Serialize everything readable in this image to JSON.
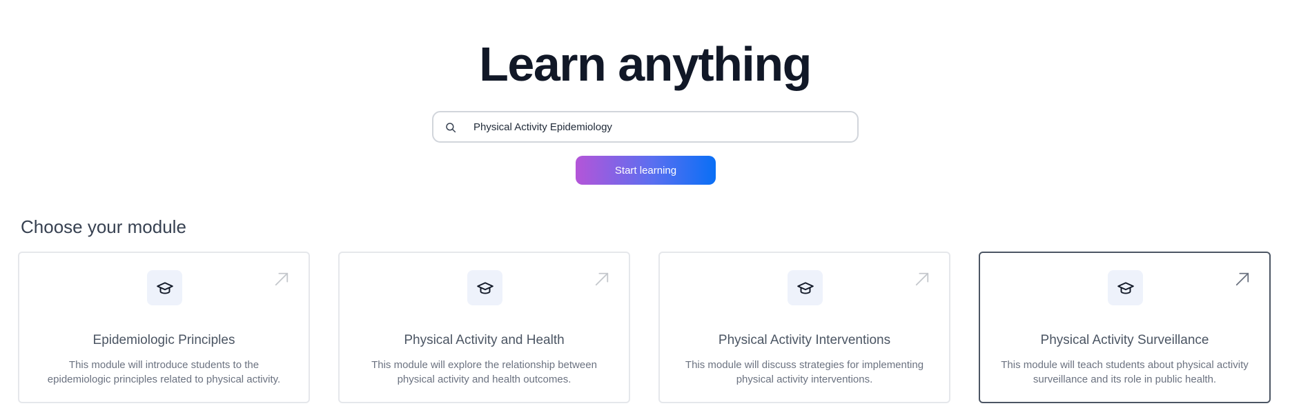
{
  "hero": {
    "title": "Learn anything"
  },
  "search": {
    "value": "Physical Activity Epidemiology",
    "icon": "search-icon"
  },
  "start_button": {
    "label": "Start learning"
  },
  "modules": {
    "heading": "Choose your module",
    "items": [
      {
        "title": "Epidemiologic Principles",
        "description": "This module will introduce students to the epidemiologic principles related to physical activity.",
        "icon": "graduation-cap-icon",
        "selected": false
      },
      {
        "title": "Physical Activity and Health",
        "description": "This module will explore the relationship between physical activity and health outcomes.",
        "icon": "graduation-cap-icon",
        "selected": false
      },
      {
        "title": "Physical Activity Interventions",
        "description": "This module will discuss strategies for implementing physical activity interventions.",
        "icon": "graduation-cap-icon",
        "selected": false
      },
      {
        "title": "Physical Activity Surveillance",
        "description": "This module will teach students about physical activity surveillance and its role in public health.",
        "icon": "graduation-cap-icon",
        "selected": true
      }
    ]
  },
  "colors": {
    "title": "#111827",
    "button_gradient_start": "#b455d8",
    "button_gradient_end": "#0a6ff5",
    "card_border": "#e5e7eb",
    "card_border_selected": "#4b5563",
    "icon_box_bg": "#eef2fb"
  }
}
